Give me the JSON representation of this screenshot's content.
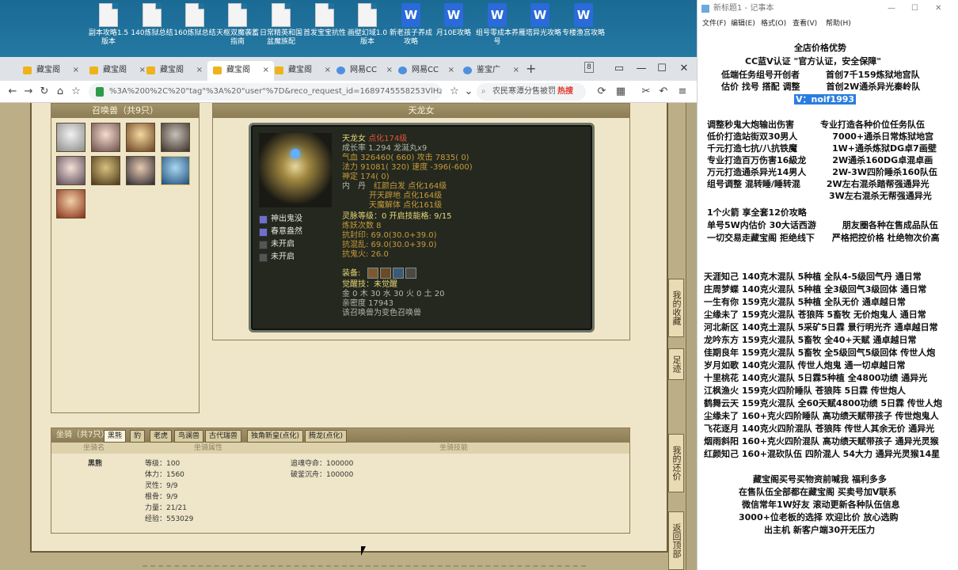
{
  "desktop": {
    "icons": [
      {
        "label": "副本攻略1.5版本",
        "type": "doc"
      },
      {
        "label": "140炼狱总结",
        "type": "doc"
      },
      {
        "label": "160炼狱总结",
        "type": "doc"
      },
      {
        "label": "天枢双魔袭蓄指南",
        "type": "doc"
      },
      {
        "label": "日常精英和国盆魔族配",
        "type": "doc"
      },
      {
        "label": "首发宝宝抗性",
        "type": "doc"
      },
      {
        "label": "画壁幻域1.0版本",
        "type": "doc"
      },
      {
        "label": "新老孩子养成攻略",
        "type": "wps"
      },
      {
        "label": "月10E攻略",
        "type": "wps"
      },
      {
        "label": "组号零成本养号",
        "type": "wps"
      },
      {
        "label": "雁塔异光攻略",
        "type": "wps"
      },
      {
        "label": "专楼渔宫攻略",
        "type": "wps"
      }
    ]
  },
  "browser": {
    "tabs": [
      {
        "label": "藏宝阁",
        "icon": "treasure-icon"
      },
      {
        "label": "藏宝阁",
        "icon": "treasure-icon"
      },
      {
        "label": "藏宝阁",
        "icon": "treasure-icon"
      },
      {
        "label": "藏宝阁",
        "icon": "treasure-icon",
        "active": true
      },
      {
        "label": "藏宝阁",
        "icon": "treasure-icon"
      },
      {
        "label": "网易CC",
        "icon": "cc-icon"
      },
      {
        "label": "网易CC",
        "icon": "cc-icon"
      },
      {
        "label": "鉴宝广",
        "icon": "globe-icon"
      }
    ],
    "tab_count_badge": "8",
    "url": "%3A%200%2C%20\"tag\"%3A%20\"user\"%7D&reco_request_id=1689745558253VlHzr",
    "search_text": "农民寒潭分售被罚",
    "search_badge": "热搜"
  },
  "game": {
    "summon_panel": {
      "title": "召唤兽（共9只）"
    },
    "pet_panel": {
      "title": "天龙女",
      "name": "天龙女",
      "status": "点化174级",
      "growth": "成长率 1.294 龙涎丸x9",
      "hp": "气血 326460( 660)",
      "attack": "攻击 7835( 0)",
      "mp": "法力 91081( 320)",
      "speed": "速度 -396(-600)",
      "soul": "神定 174( 0)",
      "inner_label": "内　丹",
      "inner1": "红颜白发 点化164级",
      "inner2": "开天辟地 点化164级",
      "inner3": "天魔解体 点化161级",
      "skills": [
        {
          "label": "神出鬼没",
          "icon": "skill-icon"
        },
        {
          "label": "春意盎然",
          "icon": "skill-icon"
        },
        {
          "label": "未开启",
          "icon": "locked-icon"
        },
        {
          "label": "未开启",
          "icon": "locked-icon"
        }
      ],
      "spirit": "灵脉等级：0 开启技能格: 9/15",
      "refine": "炼妖次数 8",
      "resist_seal": "抗封印: 69.0(30.0+39.0)",
      "resist_chaos": "抗混乱: 69.0(30.0+39.0)",
      "resist_ghost": "抗鬼火: 26.0",
      "equip_label": "装备:",
      "awaken": "觉醒技：未觉醒",
      "elements": "金 0 木 30 水 30 火 0 土 20",
      "intimacy": "亲密度 17943",
      "note": "该召唤兽为变色召唤兽"
    },
    "mount_panel": {
      "title": "坐骑（共7只）",
      "tabs": [
        "黑熊",
        "豹",
        "老虎",
        "鸟澜兽",
        "古代瑞兽",
        "独角新皇(点化)",
        "腾龙(点化)"
      ],
      "headers": [
        "坐骑名",
        "坐骑属性",
        "坐骑技能"
      ],
      "name": "黑熊",
      "attrs": [
        "等级：100",
        "体力：1560",
        "灵性：9/9",
        "根骨：9/9",
        "力量：21/21",
        "经验：553029"
      ],
      "skills": [
        "追魂夺命：100000",
        "破釜沉舟：100000"
      ]
    },
    "side_buttons": [
      "我的收藏",
      "足迹",
      "我的还价",
      "返回顶部"
    ]
  },
  "notepad": {
    "title": "新标题1 - 记事本",
    "menu": [
      "文件(F)",
      "编辑(E)",
      "格式(O)",
      "查看(V)",
      "帮助(H)"
    ],
    "lines": [
      "全店价格优势",
      "CC蓝V认证 \"官方认证，安全保障\"",
      "低端任务组号开创者　　　首创7千159炼狱地宫队",
      "估价 找号 搭配 调整　　　首创2W通杀异光秦岭队",
      "V：noif1993",
      "调整秒鬼大炮输出伤害　　　专业打造各种价位任务队伍",
      "低价打造站街双30男人　　　　7000+通杀日常炼狱地宫",
      "千元打造七抗/八抗铁魔　　　　1W+通杀炼狱DG卓7画壁",
      "专业打造百万伤害16級龙　　　2W通杀160DG卓混卓画",
      "万元打造通杀异光14男人　　　2W-3W四阶睡杀160队伍",
      "组号调整 混转睡/睡转混　　　2W左右混杀踏帮强通异光",
      "　　　　　　　　　　　　　　3W左右混杀无帮强通异光",
      "1个火箭 享全套12价攻略",
      "单号5W内估价 30大话西游　　　朋友圈各种在售成品队伍",
      "一切交易走藏宝阁 拒绝线下　　严格把控价格 杜绝物次价高",
      "天涯知己 140克木混队 5种植 全队4-5级回气丹 通日常",
      "庄周梦蝶 140克火混队 5种植 全3级回气3级回体 通日常",
      "一生有你 159克火混队 5种植 全队无价 通卓越日常",
      "尘缘未了 159克火混队 苍狼阵 5畜牧 无价炮鬼人 通日常",
      "河北新区 140克土混队 5采矿5日霖 景行明光齐 通卓越日常",
      "龙吟东方 159克火混队 5畜牧 全40+天赋 通卓越日常",
      "佳期良年 159克火混队 5畜牧 全5级回气5级回体 传世人炮",
      "岁月如歌 140克火混队 传世人炮鬼 通一切卓越日常",
      "十里桃花 140克火混队 5日霖5种植 全4800功绩 通异光",
      "江枫渔火 159克火四阶睡队 苍狼阵 5日霖 传世炮人",
      "鹤舞云天 159克火混队 全60天赋4800功绩 5日霖 传世人炮",
      "尘缘未了 160+克火四阶睡队 高功绩天赋带孩子 传世炮鬼人",
      "飞花逐月 140克火四阶混队 苍狼阵 传世人其余无价 通异光",
      "烟雨斜阳 160+克火四阶混队 高功绩天赋带孩子 通异光灵猴",
      "红颜知己 160+混砍队伍 四阶混人 54大力 通异光灵猴14星",
      "藏宝阁买号买物资前喊我 福利多多",
      "在售队伍全部都在藏宝阁 买卖号加V联系",
      "微信常年1W好友 滚动更新各种队伍信息",
      "3000+位老板的选择 欢迎比价 放心选购",
      "出主机 新客户端30开无压力"
    ]
  }
}
